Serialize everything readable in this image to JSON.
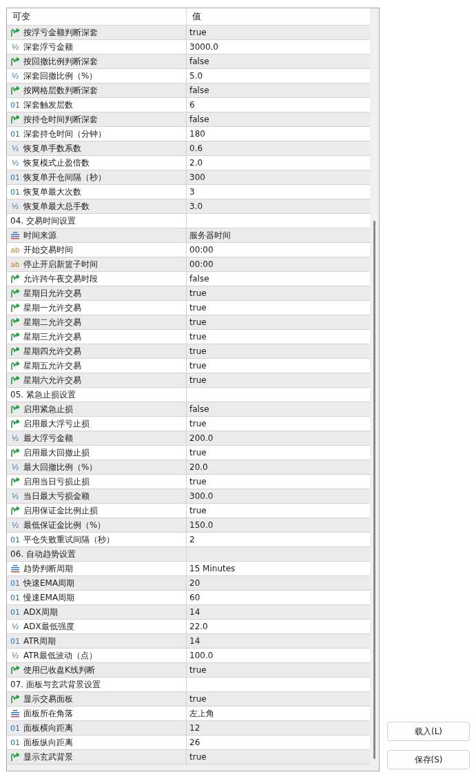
{
  "table": {
    "columns": [
      "可变",
      "值"
    ],
    "rows": [
      {
        "kind": "bool",
        "name": "按浮亏金额判断深套",
        "value": "true"
      },
      {
        "kind": "double",
        "icon": "½",
        "name": "深套浮亏金额",
        "value": "3000.0"
      },
      {
        "kind": "bool",
        "name": "按回撤比例判断深套",
        "value": "false"
      },
      {
        "kind": "double",
        "icon": "½",
        "name": "深套回撤比例（%）",
        "value": "5.0"
      },
      {
        "kind": "bool",
        "name": "按网格层数判断深套",
        "value": "false"
      },
      {
        "kind": "int",
        "icon": "01",
        "name": "深套触发层数",
        "value": "6"
      },
      {
        "kind": "bool",
        "name": "按持仓时间判断深套",
        "value": "false"
      },
      {
        "kind": "int",
        "icon": "01",
        "name": "深套持仓时间（分钟）",
        "value": "180"
      },
      {
        "kind": "double",
        "icon": "½",
        "name": "恢复单手数系数",
        "value": "0.6"
      },
      {
        "kind": "double",
        "icon": "½",
        "name": "恢复模式止盈倍数",
        "value": "2.0"
      },
      {
        "kind": "int",
        "icon": "01",
        "name": "恢复单开仓间隔（秒）",
        "value": "300"
      },
      {
        "kind": "int",
        "icon": "01",
        "name": "恢复单最大次数",
        "value": "3"
      },
      {
        "kind": "double",
        "icon": "½",
        "name": "恢复单最大总手数",
        "value": "3.0"
      },
      {
        "kind": "section",
        "name": "04. 交易时间设置"
      },
      {
        "kind": "enum",
        "name": "时间来源",
        "value": "服务器时间"
      },
      {
        "kind": "string",
        "icon": "ab",
        "name": "开始交易时间",
        "value": "00:00"
      },
      {
        "kind": "string",
        "icon": "ab",
        "name": "停止开启新篮子时间",
        "value": "00:00"
      },
      {
        "kind": "bool",
        "name": "允许跨午夜交易时段",
        "value": "false"
      },
      {
        "kind": "bool",
        "name": "星期日允许交易",
        "value": "true"
      },
      {
        "kind": "bool",
        "name": "星期一允许交易",
        "value": "true"
      },
      {
        "kind": "bool",
        "name": "星期二允许交易",
        "value": "true"
      },
      {
        "kind": "bool",
        "name": "星期三允许交易",
        "value": "true"
      },
      {
        "kind": "bool",
        "name": "星期四允许交易",
        "value": "true"
      },
      {
        "kind": "bool",
        "name": "星期五允许交易",
        "value": "true"
      },
      {
        "kind": "bool",
        "name": "星期六允许交易",
        "value": "true"
      },
      {
        "kind": "section",
        "name": "05. 紧急止损设置"
      },
      {
        "kind": "bool",
        "name": "启用紧急止损",
        "value": "false"
      },
      {
        "kind": "bool",
        "name": "启用最大浮亏止损",
        "value": "true"
      },
      {
        "kind": "double",
        "icon": "½",
        "name": "最大浮亏金额",
        "value": "200.0"
      },
      {
        "kind": "bool",
        "name": "启用最大回撤止损",
        "value": "true"
      },
      {
        "kind": "double",
        "icon": "½",
        "name": "最大回撤比例（%）",
        "value": "20.0"
      },
      {
        "kind": "bool",
        "name": "启用当日亏损止损",
        "value": "true"
      },
      {
        "kind": "double",
        "icon": "½",
        "name": "当日最大亏损金额",
        "value": "300.0"
      },
      {
        "kind": "bool",
        "name": "启用保证金比例止损",
        "value": "true"
      },
      {
        "kind": "double",
        "icon": "½",
        "name": "最低保证金比例（%）",
        "value": "150.0"
      },
      {
        "kind": "int",
        "icon": "01",
        "name": "平仓失败重试间隔（秒）",
        "value": "2"
      },
      {
        "kind": "section",
        "name": "06. 自动趋势设置"
      },
      {
        "kind": "enum",
        "name": "趋势判断周期",
        "value": "15 Minutes"
      },
      {
        "kind": "int",
        "icon": "01",
        "name": "快速EMA周期",
        "value": "20"
      },
      {
        "kind": "int",
        "icon": "01",
        "name": "慢速EMA周期",
        "value": "60"
      },
      {
        "kind": "int",
        "icon": "01",
        "name": "ADX周期",
        "value": "14"
      },
      {
        "kind": "double",
        "icon": "½",
        "name": "ADX最低强度",
        "value": "22.0"
      },
      {
        "kind": "int",
        "icon": "01",
        "name": "ATR周期",
        "value": "14"
      },
      {
        "kind": "double",
        "icon": "½",
        "name": "ATR最低波动（点）",
        "value": "100.0"
      },
      {
        "kind": "bool",
        "name": "使用已收盘K线判断",
        "value": "true"
      },
      {
        "kind": "section",
        "name": "07. 面板与玄武背景设置"
      },
      {
        "kind": "bool",
        "name": "显示交易面板",
        "value": "true"
      },
      {
        "kind": "enum",
        "name": "面板所在角落",
        "value": "左上角"
      },
      {
        "kind": "int",
        "icon": "01",
        "name": "面板横向距离",
        "value": "12"
      },
      {
        "kind": "int",
        "icon": "01",
        "name": "面板纵向距离",
        "value": "26"
      },
      {
        "kind": "bool",
        "name": "显示玄武背景",
        "value": "true"
      }
    ]
  },
  "buttons": [
    "载入(L)",
    "保存(S)"
  ]
}
